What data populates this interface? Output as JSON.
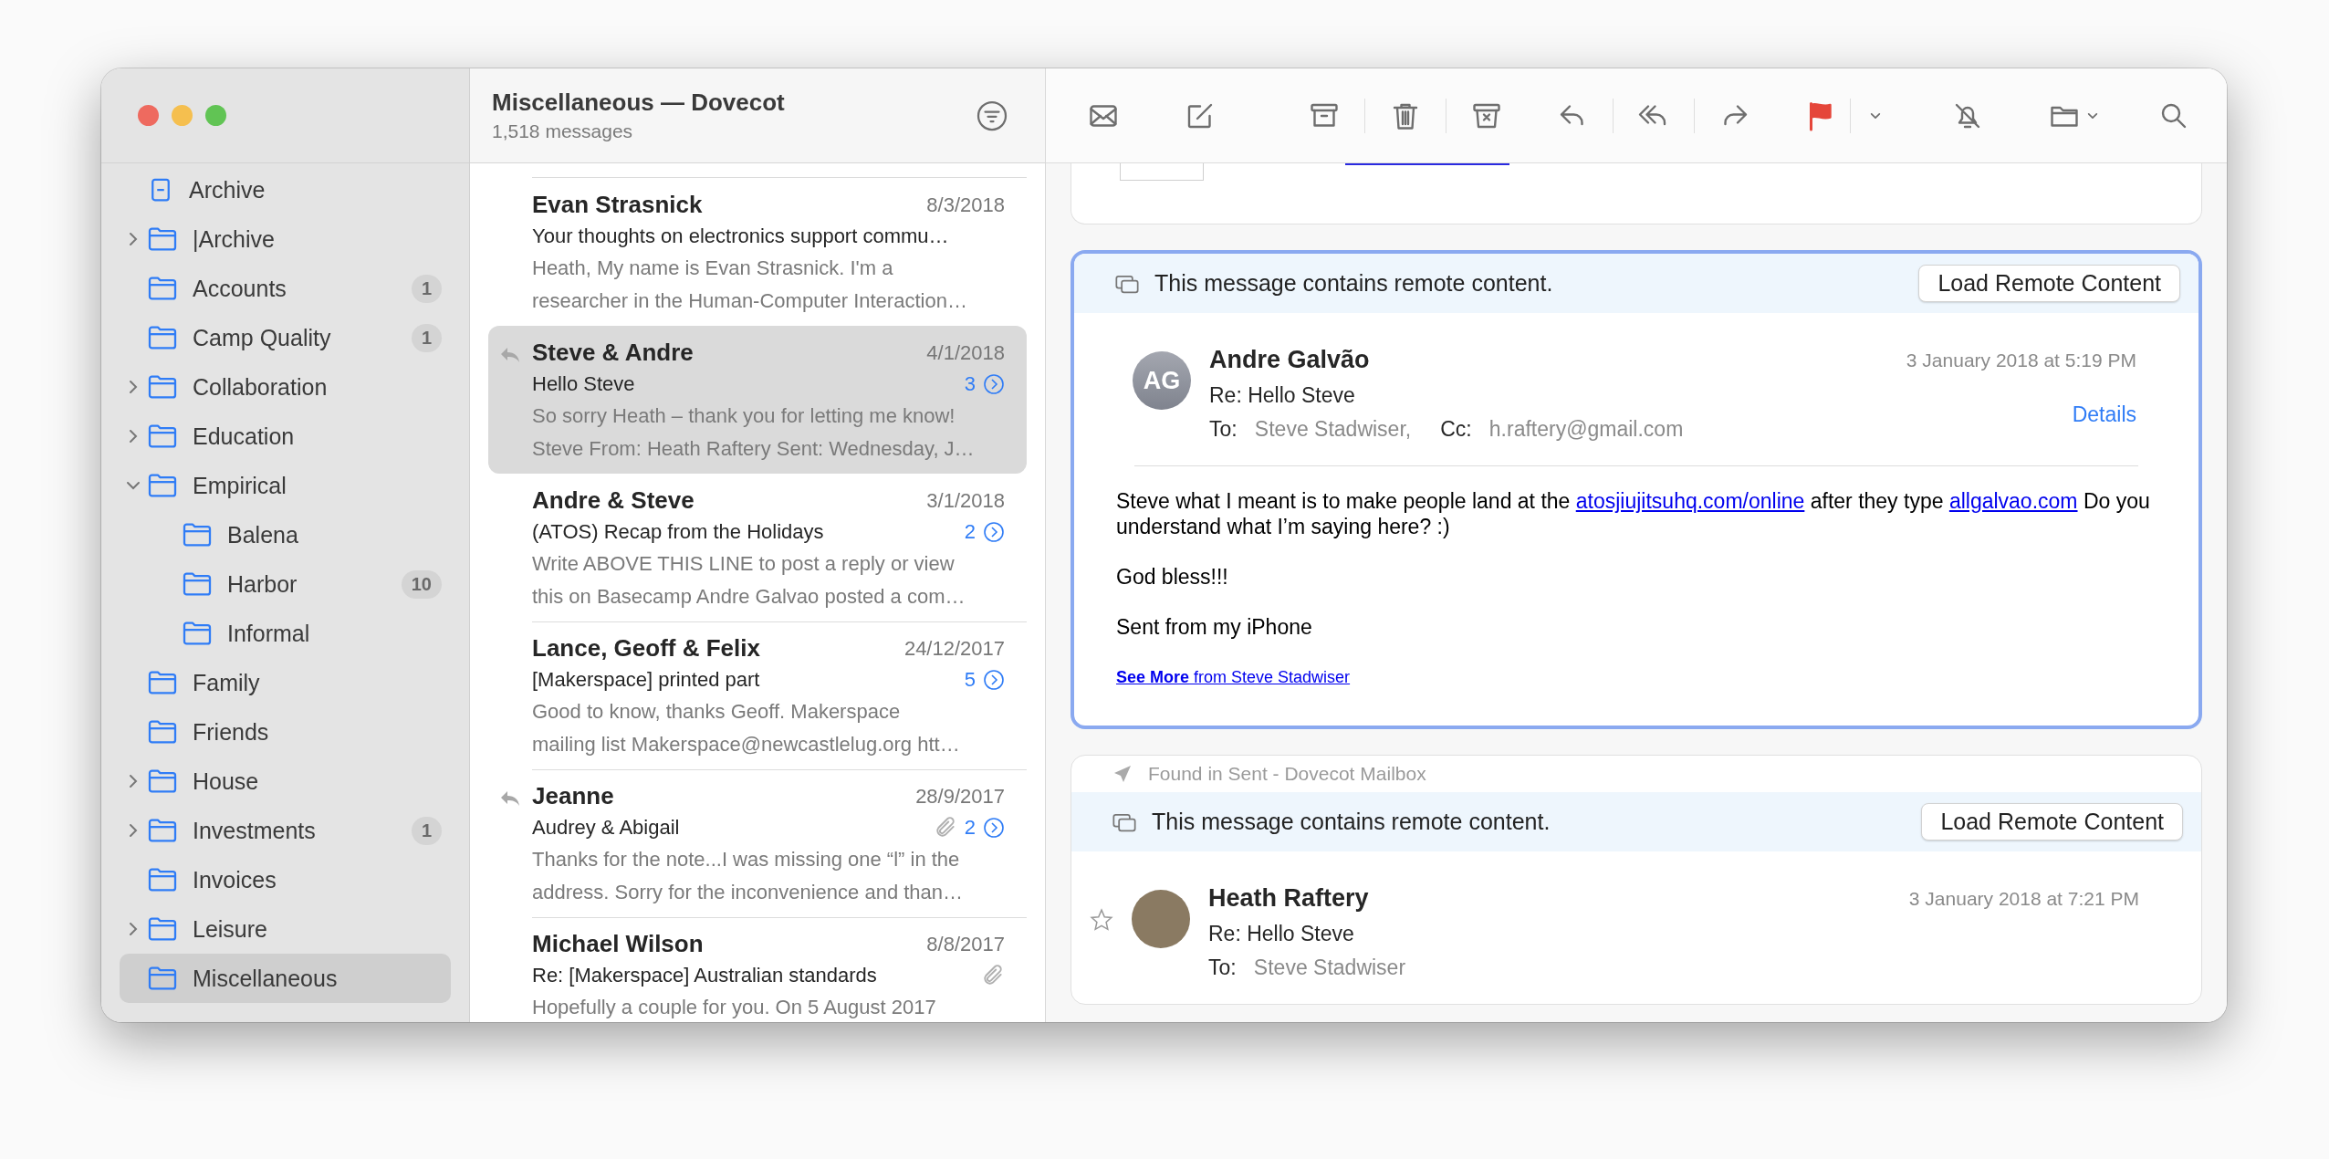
{
  "window": {
    "title": "Miscellaneous — Dovecot",
    "subtitle": "1,518 messages"
  },
  "sidebar": {
    "items": [
      {
        "label": "Archive",
        "kind": "archive",
        "selected": false
      },
      {
        "label": "|Archive",
        "kind": "group",
        "expanded": false,
        "selected": false
      },
      {
        "label": "Accounts",
        "kind": "folder",
        "badge": "1",
        "selected": false
      },
      {
        "label": "Camp Quality",
        "kind": "folder",
        "badge": "1",
        "selected": false
      },
      {
        "label": "Collaboration",
        "kind": "group",
        "expanded": false,
        "selected": false
      },
      {
        "label": "Education",
        "kind": "group",
        "expanded": false,
        "selected": false
      },
      {
        "label": "Empirical",
        "kind": "group",
        "expanded": true,
        "selected": false,
        "children": [
          {
            "label": "Balena",
            "kind": "folder",
            "selected": false
          },
          {
            "label": "Harbor",
            "kind": "folder",
            "badge": "10",
            "selected": false
          },
          {
            "label": "Informal",
            "kind": "folder",
            "selected": false
          }
        ]
      },
      {
        "label": "Family",
        "kind": "folder",
        "selected": false
      },
      {
        "label": "Friends",
        "kind": "folder",
        "selected": false
      },
      {
        "label": "House",
        "kind": "group",
        "expanded": false,
        "selected": false
      },
      {
        "label": "Investments",
        "kind": "group",
        "expanded": false,
        "badge": "1",
        "selected": false
      },
      {
        "label": "Invoices",
        "kind": "folder",
        "selected": false
      },
      {
        "label": "Leisure",
        "kind": "group",
        "expanded": false,
        "selected": false
      },
      {
        "label": "Miscellaneous",
        "kind": "folder",
        "selected": true
      }
    ]
  },
  "message_list": {
    "messages": [
      {
        "sender": "Evan Strasnick",
        "date": "8/3/2018",
        "subject": "Your thoughts on electronics support commu…",
        "preview": [
          "Heath, My name is Evan Strasnick. I'm a",
          "researcher in the Human-Computer Interaction…"
        ],
        "replied": false,
        "attachment": false,
        "selected": false
      },
      {
        "sender": "Steve & Andre",
        "date": "4/1/2018",
        "subject": "Hello Steve",
        "thread_count": "3",
        "preview": [
          "So sorry Heath – thank you for letting me know!",
          "Steve From: Heath Raftery Sent: Wednesday, J…"
        ],
        "replied": true,
        "attachment": false,
        "selected": true
      },
      {
        "sender": "Andre & Steve",
        "date": "3/1/2018",
        "subject": "(ATOS) Recap from the Holidays",
        "thread_count": "2",
        "preview": [
          "Write ABOVE THIS LINE to post a reply or view",
          "this on Basecamp Andre Galvao posted a com…"
        ],
        "replied": false,
        "attachment": false,
        "selected": false
      },
      {
        "sender": "Lance, Geoff & Felix",
        "date": "24/12/2017",
        "subject": "[Makerspace] printed part",
        "thread_count": "5",
        "preview": [
          "Good to know, thanks Geoff. Makerspace",
          "mailing list Makerspace@newcastlelug.org htt…"
        ],
        "replied": false,
        "attachment": false,
        "selected": false
      },
      {
        "sender": "Jeanne",
        "date": "28/9/2017",
        "subject": "Audrey & Abigail",
        "thread_count": "2",
        "preview": [
          "Thanks for the note...I was missing one “l” in the",
          "address. Sorry for the inconvenience and than…"
        ],
        "replied": true,
        "attachment": true,
        "selected": false
      },
      {
        "sender": "Michael Wilson",
        "date": "8/8/2017",
        "subject": "Re: [Makerspace] Australian standards",
        "preview": [
          "Hopefully a couple for you. On 5 August 2017"
        ],
        "replied": false,
        "attachment": true,
        "selected": false
      }
    ]
  },
  "viewer": {
    "messages": [
      {
        "focused": true,
        "remote_notice": "This message contains remote content.",
        "load_button": "Load Remote Content",
        "avatar": {
          "kind": "initials",
          "text": "AG"
        },
        "sender": "Andre Galvão",
        "date": "3 January 2018 at 5:19 PM",
        "subject": "Re: Hello Steve",
        "to_label": "To:",
        "to": "Steve Stadwiser,",
        "cc_label": "Cc:",
        "cc": "h.raftery@gmail.com",
        "details": "Details",
        "body": [
          [
            {
              "text": "Steve what I meant is to make people land at the ",
              "link": false
            },
            {
              "text": "atosjiujitsuhq.com/online",
              "link": true
            },
            {
              "text": " after they type ",
              "link": false
            },
            {
              "text": "allgalvao.com",
              "link": true
            },
            {
              "text": " Do you understand what I’m saying here? :)",
              "link": false
            }
          ],
          [
            {
              "text": "God bless!!!",
              "link": false
            }
          ],
          [
            {
              "text": "Sent from my iPhone",
              "link": false
            }
          ]
        ],
        "footer_link": "**See More** from Steve Stadwiser"
      },
      {
        "focused": false,
        "found_in": "Found in Sent - Dovecot Mailbox",
        "remote_notice": "This message contains remote content.",
        "load_button": "Load Remote Content",
        "avatar": {
          "kind": "photo"
        },
        "starred": false,
        "sender": "Heath Raftery",
        "date": "3 January 2018 at 7:21 PM",
        "subject": "Re: Hello Steve",
        "to_label": "To:",
        "to": "Steve Stadwiser"
      }
    ]
  }
}
